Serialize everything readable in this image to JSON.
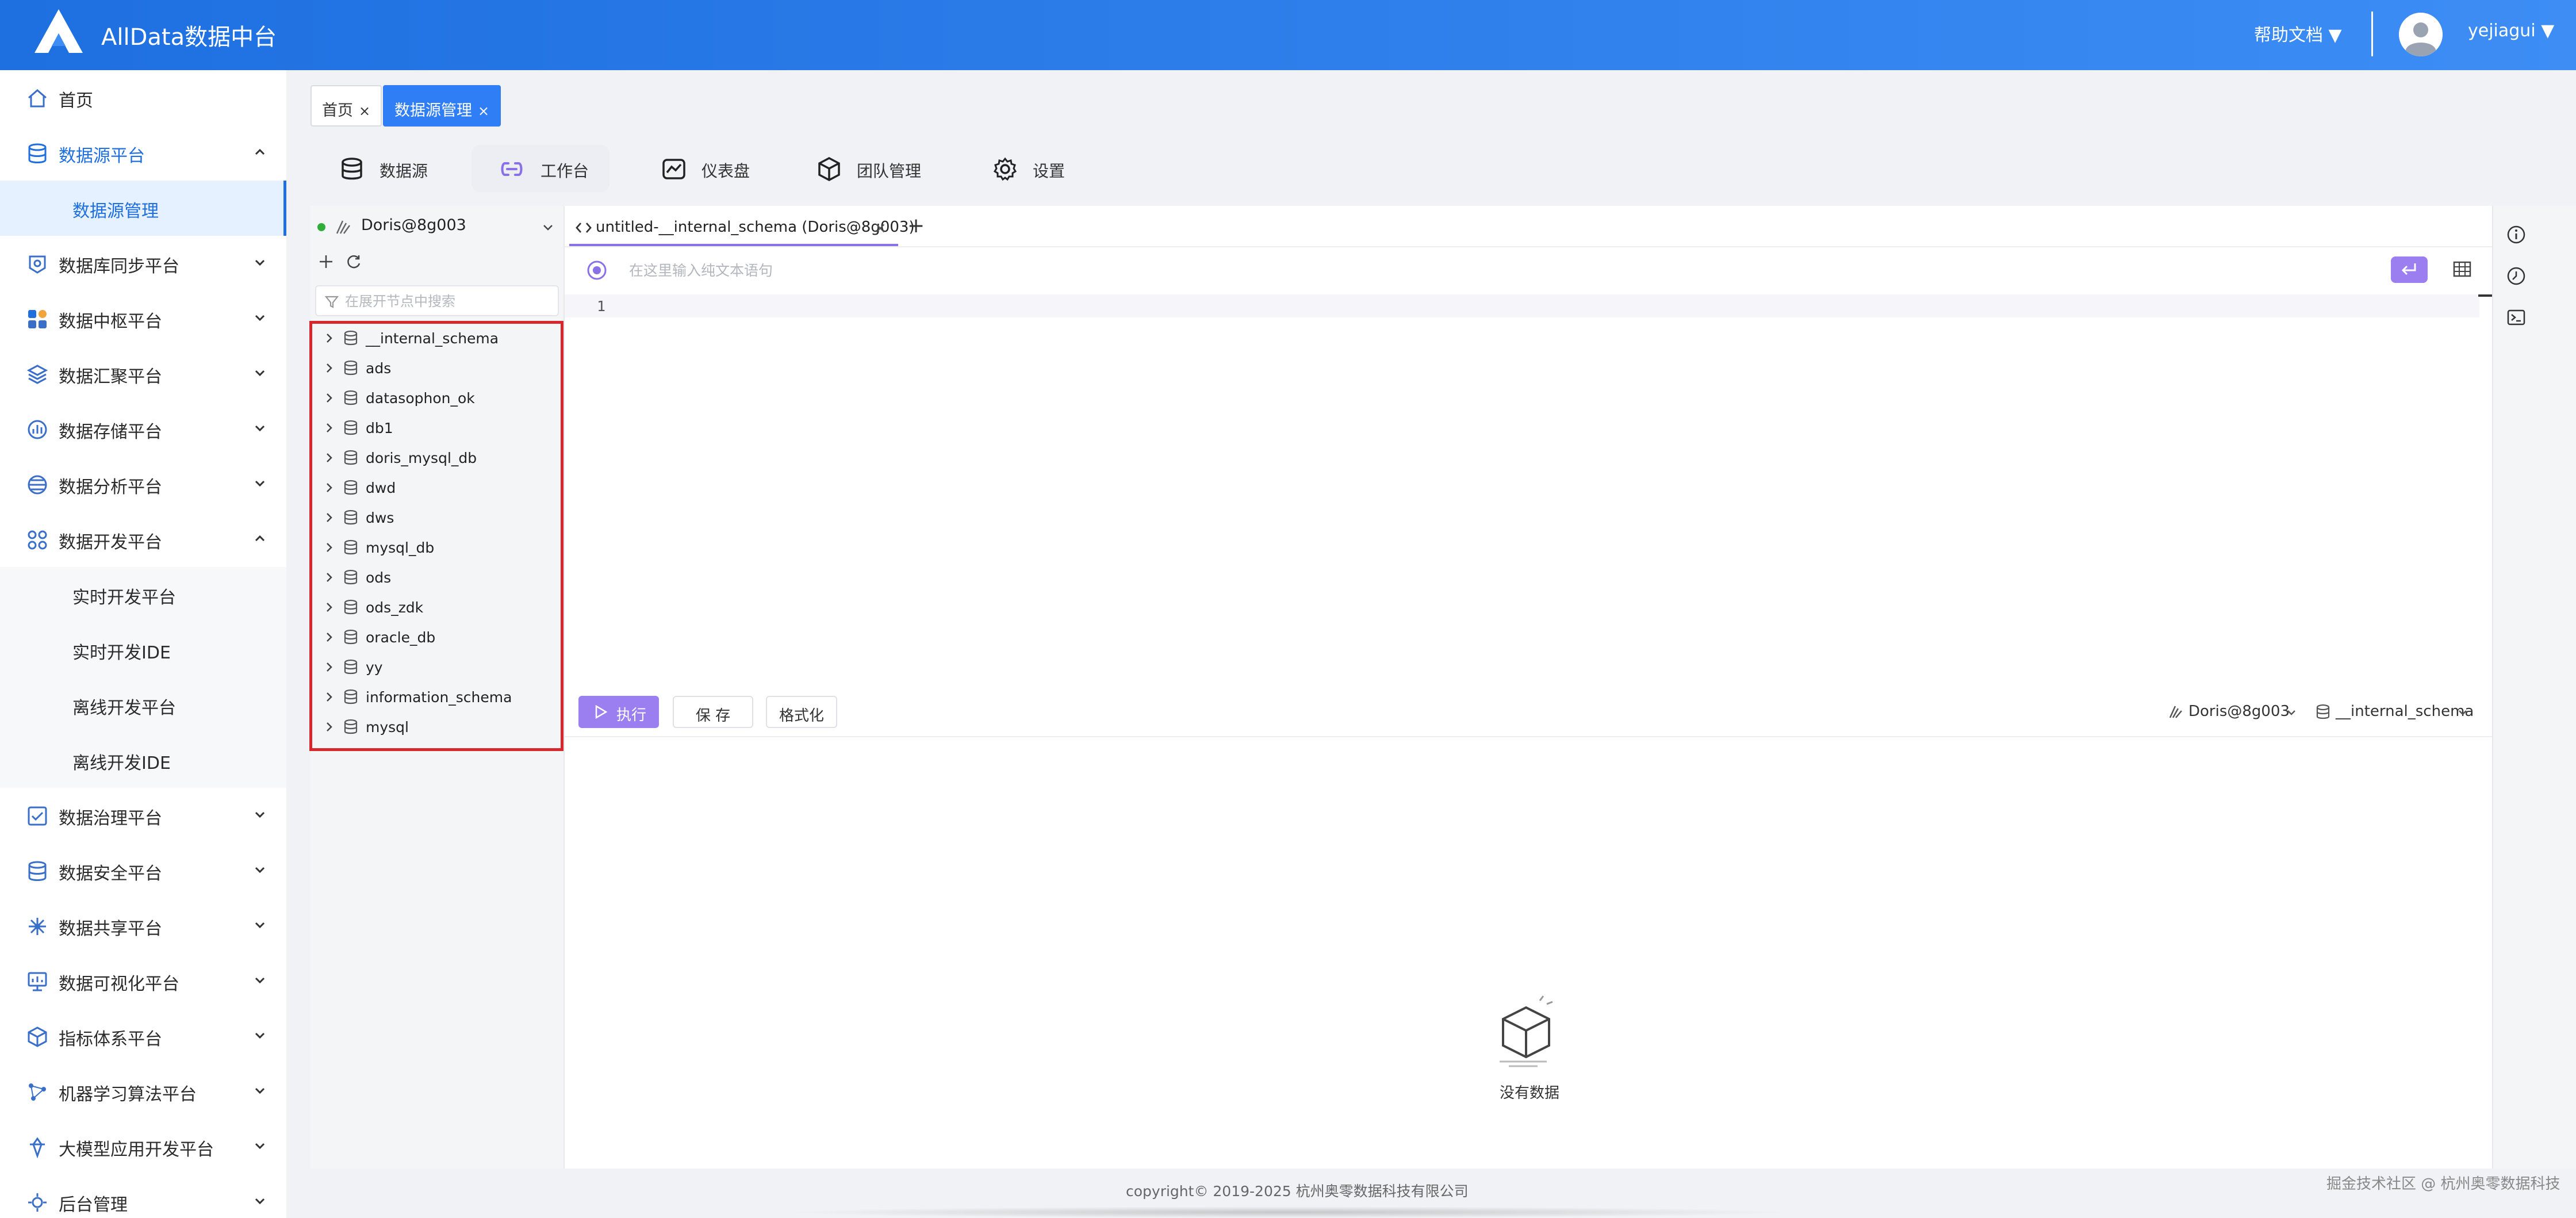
{
  "header": {
    "app_title": "AllData数据中台",
    "help_docs": "帮助文档 ▼",
    "username": "yejiagui ▼"
  },
  "sidebar": {
    "items": [
      {
        "label": "首页",
        "icon": "home-icon"
      },
      {
        "label": "数据源平台",
        "icon": "database-icon",
        "expanded": true,
        "children": [
          {
            "label": "数据源管理",
            "selected": true
          }
        ]
      },
      {
        "label": "数据库同步平台",
        "icon": "sync-icon"
      },
      {
        "label": "数据中枢平台",
        "icon": "hub-icon"
      },
      {
        "label": "数据汇聚平台",
        "icon": "layers-icon"
      },
      {
        "label": "数据存储平台",
        "icon": "storage-icon"
      },
      {
        "label": "数据分析平台",
        "icon": "analytics-icon"
      },
      {
        "label": "数据开发平台",
        "icon": "develop-icon",
        "expanded": true,
        "children": [
          {
            "label": "实时开发平台"
          },
          {
            "label": "实时开发IDE"
          },
          {
            "label": "离线开发平台"
          },
          {
            "label": "离线开发IDE"
          }
        ]
      },
      {
        "label": "数据治理平台",
        "icon": "governance-icon"
      },
      {
        "label": "数据安全平台",
        "icon": "security-icon"
      },
      {
        "label": "数据共享平台",
        "icon": "share-icon"
      },
      {
        "label": "数据可视化平台",
        "icon": "visual-icon"
      },
      {
        "label": "指标体系平台",
        "icon": "cube-icon"
      },
      {
        "label": "机器学习算法平台",
        "icon": "ml-icon"
      },
      {
        "label": "大模型应用开发平台",
        "icon": "llm-icon"
      },
      {
        "label": "后台管理",
        "icon": "admin-icon"
      }
    ]
  },
  "breadcrumbs": [
    {
      "label": "首页",
      "close": "×"
    },
    {
      "label": "数据源管理",
      "close": "×",
      "active": true
    }
  ],
  "module_tabs": [
    {
      "label": "数据源",
      "icon": "database-icon"
    },
    {
      "label": "工作台",
      "icon": "link-icon",
      "active": true
    },
    {
      "label": "仪表盘",
      "icon": "dashboard-icon"
    },
    {
      "label": "团队管理",
      "icon": "team-box-icon"
    },
    {
      "label": "设置",
      "icon": "gear-icon"
    }
  ],
  "tree": {
    "connection": "Doris@8g003",
    "search_placeholder": "在展开节点中搜索",
    "databases": [
      "__internal_schema",
      "ads",
      "datasophon_ok",
      "db1",
      "doris_mysql_db",
      "dwd",
      "dws",
      "mysql_db",
      "ods",
      "ods_zdk",
      "oracle_db",
      "yy",
      "information_schema",
      "mysql"
    ]
  },
  "editor": {
    "tab_label": "untitled-__internal_schema (Doris@8g003)",
    "tab_close": "×",
    "tab_add": "+",
    "prompt_placeholder": "在这里输入纯文本语句",
    "line_number": "1"
  },
  "actions": {
    "run": "执行",
    "save": "保 存",
    "format": "格式化",
    "context_connection": "Doris@8g003",
    "context_schema": "__internal_schema"
  },
  "results": {
    "empty_text": "没有数据"
  },
  "footer": {
    "copyright": "copyright© 2019-2025 杭州奥零数据科技有限公司",
    "watermark": "掘金技术社区 @ 杭州奥零数据科技"
  },
  "colors": {
    "header": "#2f7ef5",
    "accent": "#1f6fde",
    "purple": "#9b7ef0",
    "highlight": "#d9262c"
  }
}
